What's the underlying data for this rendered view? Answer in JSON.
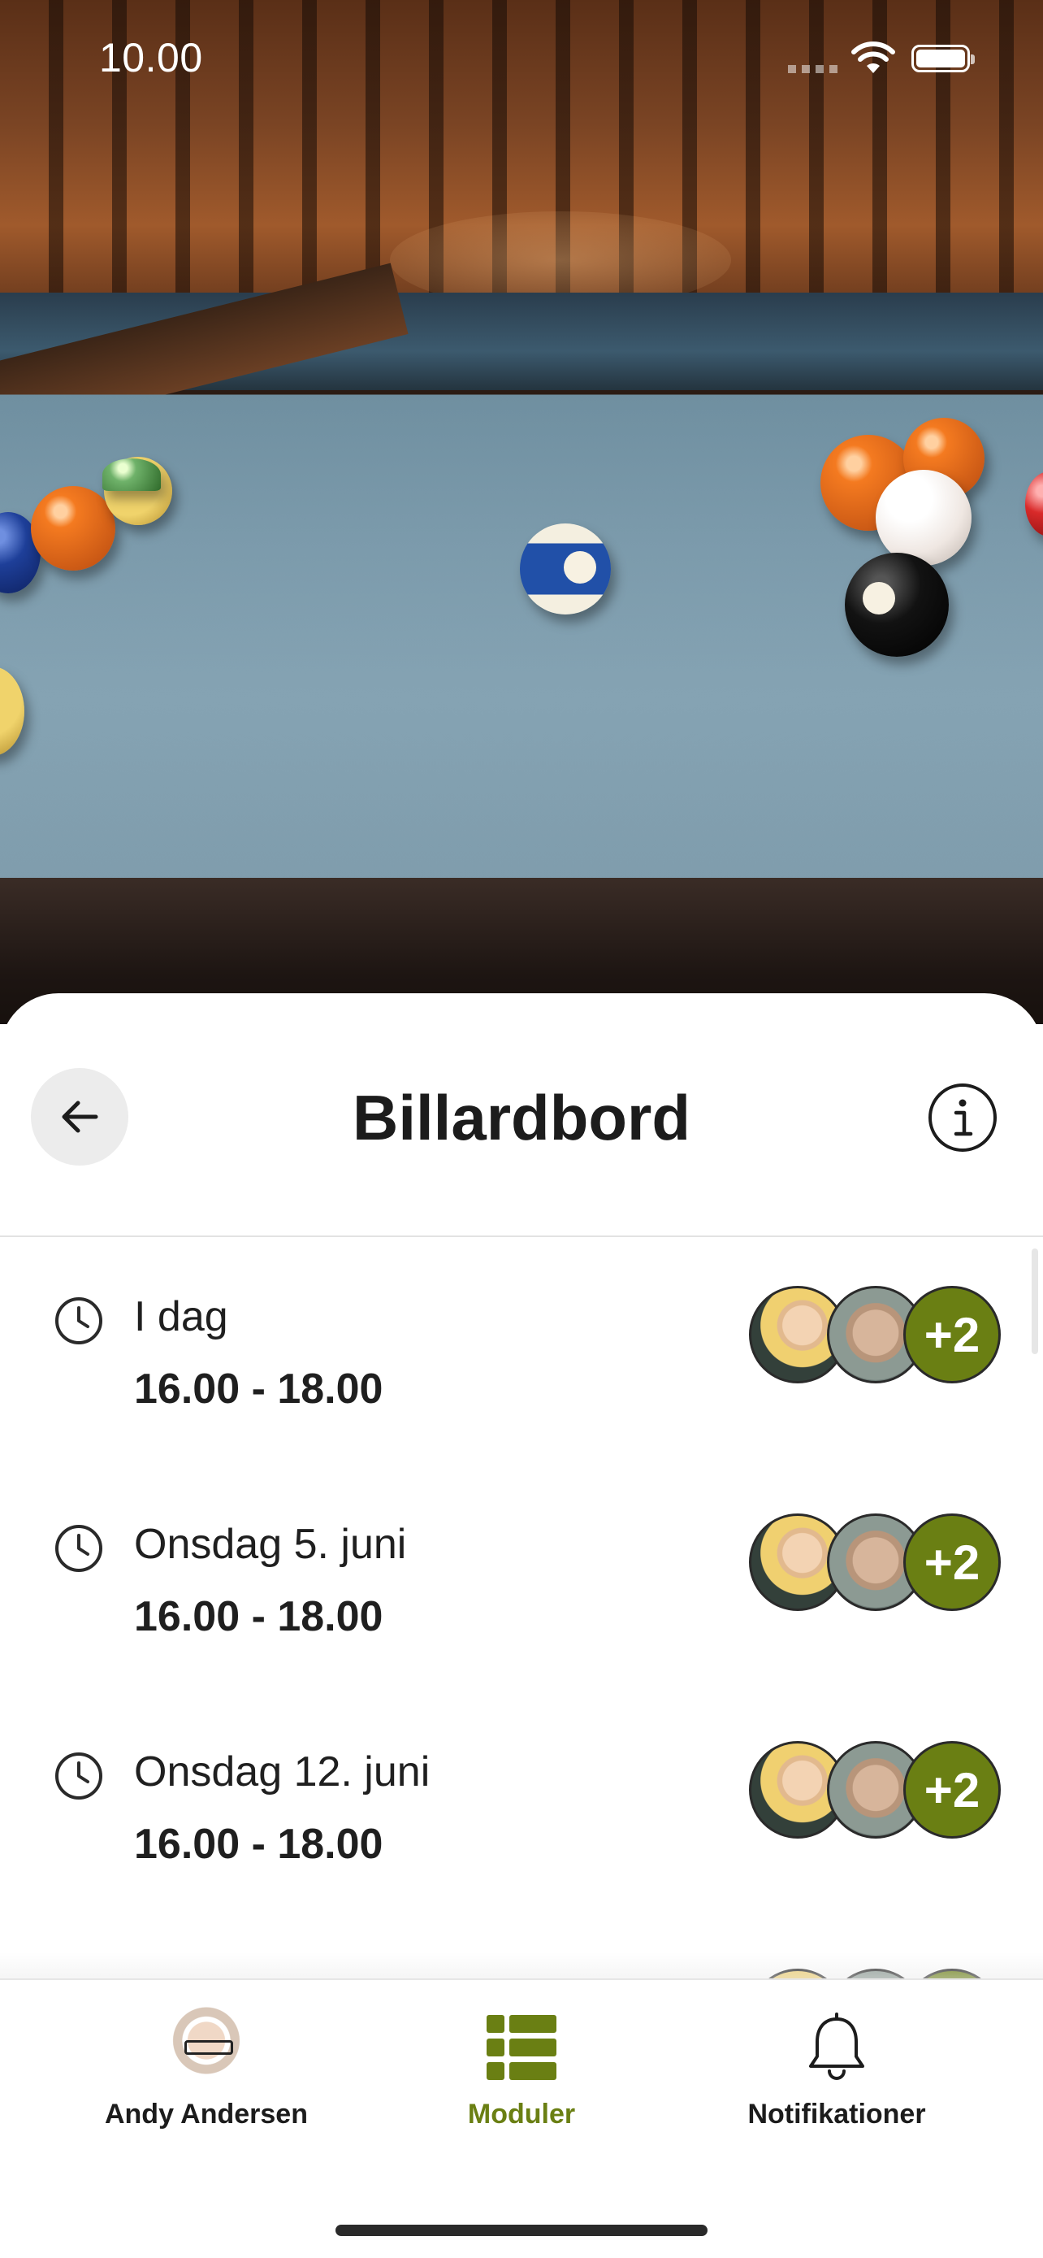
{
  "status_bar": {
    "time": "10.00"
  },
  "header": {
    "title": "Billardbord"
  },
  "bookings": [
    {
      "day": "I dag",
      "time": "16.00 - 18.00",
      "extra_count": "+2"
    },
    {
      "day": "Onsdag 5. juni",
      "time": "16.00 - 18.00",
      "extra_count": "+2"
    },
    {
      "day": "Onsdag 12. juni",
      "time": "16.00 - 18.00",
      "extra_count": "+2"
    }
  ],
  "tab_bar": {
    "items": [
      {
        "label": "Andy Andersen",
        "icon": "profile-avatar",
        "active": false
      },
      {
        "label": "Moduler",
        "icon": "grid-list-icon",
        "active": true
      },
      {
        "label": "Notifikationer",
        "icon": "bell-icon",
        "active": false
      }
    ]
  },
  "colors": {
    "accent": "#6a7f13",
    "text": "#1c1c1c",
    "background": "#ffffff"
  }
}
